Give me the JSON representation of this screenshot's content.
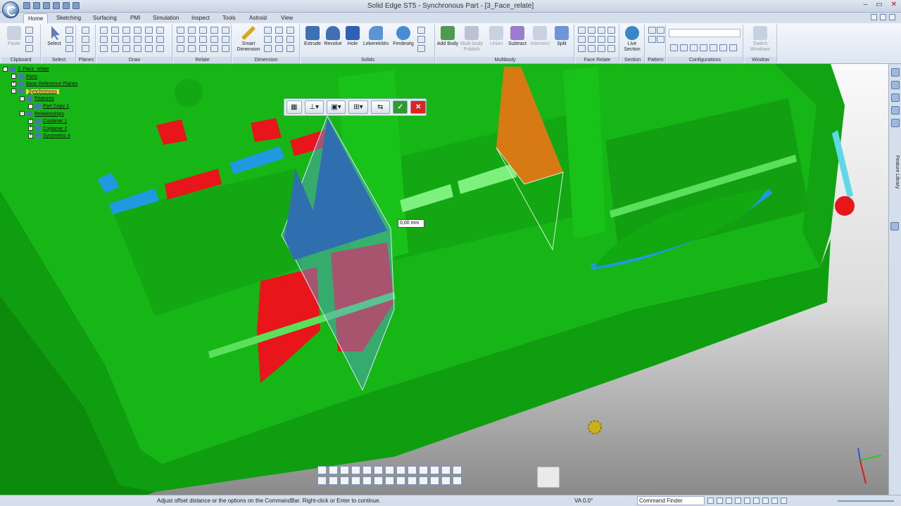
{
  "window": {
    "title": "Solid Edge ST5 - Synchronous Part - [3_Face_relate]",
    "controls": [
      "–",
      "▭",
      "✕"
    ]
  },
  "tabs": [
    "Home",
    "Sketching",
    "Surfacing",
    "PMI",
    "Simulation",
    "Inspect",
    "Tools",
    "Astroid",
    "View"
  ],
  "active_tab": "Home",
  "ribbon": {
    "groups": {
      "clipboard": "Clipboard",
      "select": "Select",
      "planes": "Planes",
      "draw": "Draw",
      "relate": "Relate",
      "dimension": "Dimension",
      "solids": "Solids",
      "multibody": "Multibody",
      "face_relate": "Face Relate",
      "section": "Section",
      "pattern": "Pattern",
      "configurations": "Configurations",
      "window": "Window"
    },
    "buttons": {
      "paste": "Paste",
      "select": "Select",
      "smart_dimension": "Smart Dimension",
      "extrude": "Extrude",
      "revolve": "Revolve",
      "hole": "Hole",
      "lekerekites": "Lekerekítés",
      "ferdeseg": "Ferdeség",
      "add_body": "Add Body",
      "multibody_publish": "Multi-body Publish",
      "union": "Union",
      "subtract": "Subtract",
      "intersect": "Intersect",
      "split": "Split",
      "live_section": "Live Section",
      "switch_windows": "Switch Windows"
    },
    "colors": {
      "extrude": "#3f6fb4",
      "revolve": "#3f6fb4",
      "hole": "#2f61b8",
      "lekerekites": "#5b93d4",
      "ferdeseg": "#4a8bd6",
      "add_body": "#4e9a4e",
      "multibody_publish": "#b9c3d3",
      "union": "#c9d2e0",
      "subtract": "#9b7ccf",
      "intersect": "#c9d2e0",
      "split": "#6f95d8",
      "live_section": "#3b86c6",
      "switch_windows": "#c6d0e0",
      "smart_dimension": "#d9a520",
      "paste": "#c9d2e0",
      "select": "#5d7fb3"
    }
  },
  "tree": [
    {
      "level": 0,
      "label": "3_Face_relate",
      "icon": "part-icon",
      "toggle": ""
    },
    {
      "level": 1,
      "label": "Parts",
      "icon": "check-icon",
      "toggle": ""
    },
    {
      "level": 1,
      "label": "Base Reference Planes",
      "icon": "planes-icon",
      "toggle": "+"
    },
    {
      "level": 1,
      "label": "Synchronous",
      "icon": "synchronous-icon",
      "toggle": "−",
      "selected": true
    },
    {
      "level": 2,
      "label": "Features",
      "icon": "features-icon",
      "toggle": "−"
    },
    {
      "level": 3,
      "label": "Part Copy 1",
      "icon": "part-copy-icon",
      "toggle": ""
    },
    {
      "level": 2,
      "label": "Relationships",
      "icon": "relationships-icon",
      "toggle": "−"
    },
    {
      "level": 3,
      "label": "Coplanar 1",
      "icon": "coplanar-icon",
      "toggle": "+"
    },
    {
      "level": 3,
      "label": "Coplanar 2",
      "icon": "coplanar-icon",
      "toggle": "+"
    },
    {
      "level": 3,
      "label": "Symmetric 4",
      "icon": "symmetric-icon",
      "toggle": "+"
    }
  ],
  "command_bar": {
    "icons": [
      "offset-plane-icon",
      "orientation-dropdown-icon",
      "keep-dropdown-icon",
      "lock-dropdown-icon",
      "relate-options-icon"
    ],
    "accept_label": "✓",
    "cancel_label": "✕"
  },
  "viewport": {
    "dimension_value": "0,00 mm",
    "model_colors": {
      "body": "#16b616",
      "body_dark": "#0f8a0f",
      "highlight_red": "#e8161a",
      "highlight_blue": "#1f9ae0",
      "plane_blue": "#2f6fb0",
      "plane_orange": "#d87a14",
      "light_green": "#7ef07e"
    }
  },
  "sidebar": {
    "label": "Feature Library"
  },
  "statusbar": {
    "message": "Adjust offset distance or the options on the CommandBar.  Right-click or Enter to continue.",
    "view_angle": "VA 0.0°",
    "command_finder": "Command Finder"
  }
}
